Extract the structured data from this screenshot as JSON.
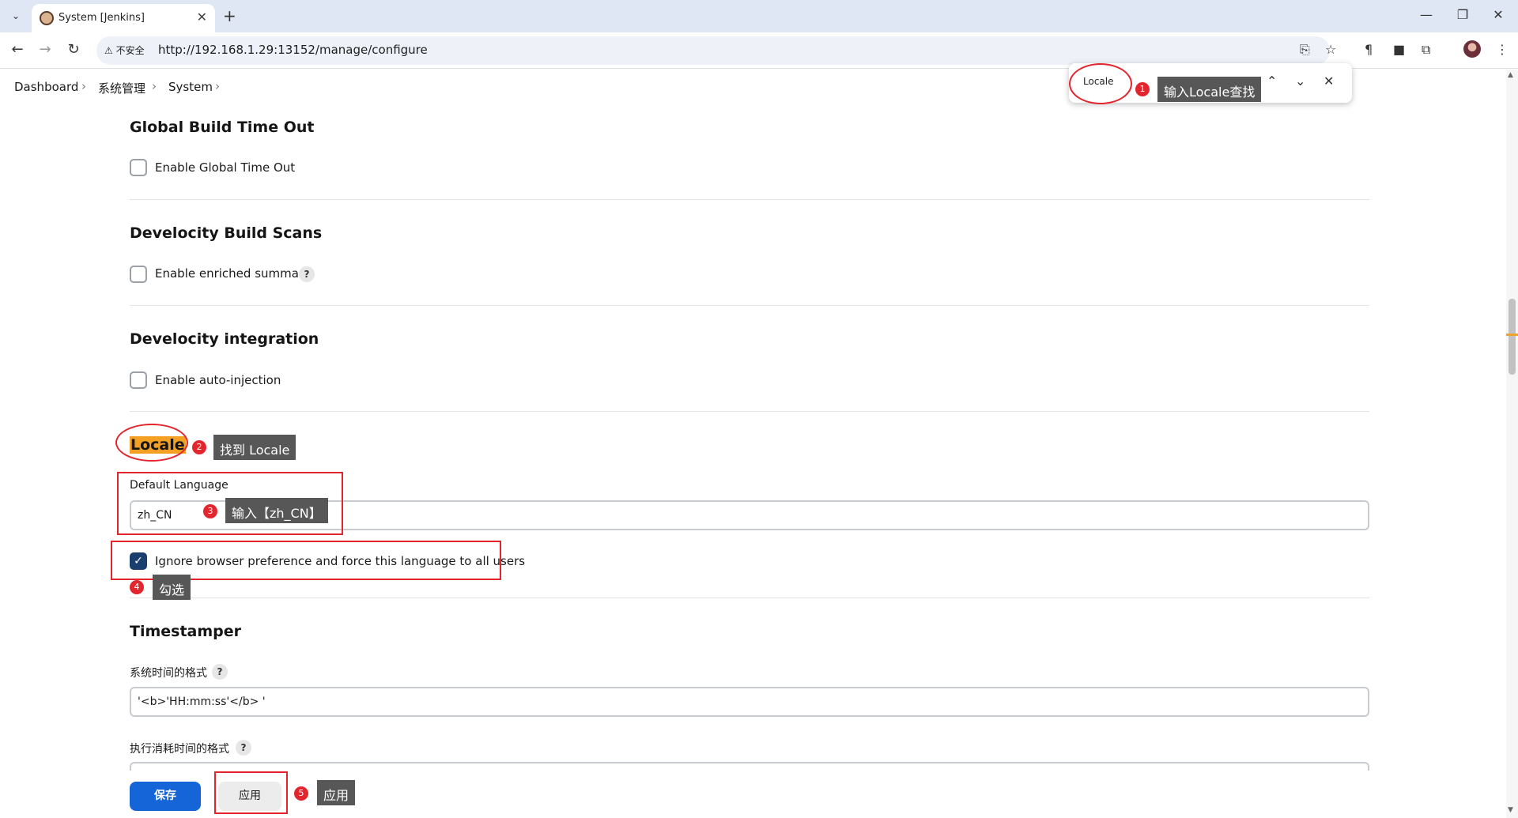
{
  "browser": {
    "tab_title": "System [Jenkins]",
    "security_label": "不安全",
    "url": "http://192.168.1.29:13152/manage/configure"
  },
  "breadcrumb": {
    "items": [
      "Dashboard",
      "系统管理",
      "System"
    ]
  },
  "find_bar": {
    "query": "Locale"
  },
  "sections": {
    "global_timeout": {
      "title": "Global Build Time Out",
      "checkbox_label": "Enable Global Time Out",
      "checked": false
    },
    "develocity_scans": {
      "title": "Develocity Build Scans",
      "checkbox_label": "Enable enriched summary",
      "checked": false
    },
    "develocity_integration": {
      "title": "Develocity integration",
      "checkbox_label": "Enable auto-injection",
      "checked": false
    },
    "locale": {
      "title": "Locale",
      "default_language_label": "Default Language",
      "default_language_value": "zh_CN",
      "force_label": "Ignore browser preference and force this language to all users",
      "force_checked": true
    },
    "timestamper": {
      "title": "Timestamper",
      "system_time_label": "系统时间的格式",
      "system_time_value": "'<b>'HH:mm:ss'</b> '",
      "elapsed_time_label": "执行消耗时间的格式"
    }
  },
  "buttons": {
    "save": "保存",
    "apply": "应用"
  },
  "annotations": [
    {
      "number": "1",
      "text": "输入Locale查找"
    },
    {
      "number": "2",
      "text": "找到 Locale"
    },
    {
      "number": "3",
      "text": "输入【zh_CN】"
    },
    {
      "number": "4",
      "text": "勾选"
    },
    {
      "number": "5",
      "text": "应用"
    }
  ],
  "colors": {
    "annotation_red": "#e3262d",
    "save_blue": "#1565d8",
    "locale_highlight": "#f3a024",
    "checkbox_checked": "#1a3f6f"
  }
}
